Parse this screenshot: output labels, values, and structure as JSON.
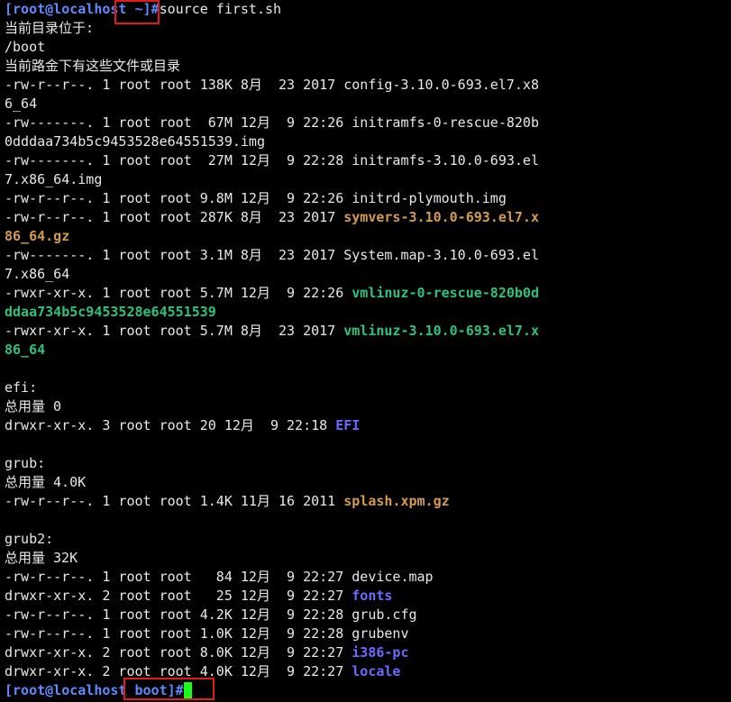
{
  "terminal": {
    "lines": [
      [
        {
          "t": "[root@localhost ~]#",
          "c": "prompt"
        },
        {
          "t": "source first.sh",
          "c": "cmd"
        }
      ],
      [
        {
          "t": "当前目录位于:",
          "c": "default"
        }
      ],
      [
        {
          "t": "/boot",
          "c": "default"
        }
      ],
      [
        {
          "t": "当前路金下有这些文件或目录",
          "c": "default"
        }
      ],
      [
        {
          "t": "-rw-r--r--. 1 root root 138K 8月  23 2017 ",
          "c": "default"
        },
        {
          "t": "config-3.10.0-693.el7.x8",
          "c": "default"
        }
      ],
      [
        {
          "t": "6_64",
          "c": "default"
        }
      ],
      [
        {
          "t": "-rw-------. 1 root root  67M 12月  9 22:26 ",
          "c": "default"
        },
        {
          "t": "initramfs-0-rescue-820b",
          "c": "default"
        }
      ],
      [
        {
          "t": "0dddaa734b5c9453528e64551539.img",
          "c": "default"
        }
      ],
      [
        {
          "t": "-rw-------. 1 root root  27M 12月  9 22:28 ",
          "c": "default"
        },
        {
          "t": "initramfs-3.10.0-693.el",
          "c": "default"
        }
      ],
      [
        {
          "t": "7.x86_64.img",
          "c": "default"
        }
      ],
      [
        {
          "t": "-rw-r--r--. 1 root root 9.8M 12月  9 22:26 ",
          "c": "default"
        },
        {
          "t": "initrd-plymouth.img",
          "c": "default"
        }
      ],
      [
        {
          "t": "-rw-r--r--. 1 root root 287K 8月  23 2017 ",
          "c": "default"
        },
        {
          "t": "symvers-3.10.0-693.el7.x",
          "c": "archive"
        }
      ],
      [
        {
          "t": "86_64.gz",
          "c": "archive"
        }
      ],
      [
        {
          "t": "-rw-------. 1 root root 3.1M 8月  23 2017 ",
          "c": "default"
        },
        {
          "t": "System.map-3.10.0-693.el",
          "c": "default"
        }
      ],
      [
        {
          "t": "7.x86_64",
          "c": "default"
        }
      ],
      [
        {
          "t": "-rwxr-xr-x. 1 root root 5.7M 12月  9 22:26 ",
          "c": "default"
        },
        {
          "t": "vmlinuz-0-rescue-820b0d",
          "c": "exec"
        }
      ],
      [
        {
          "t": "ddaa734b5c9453528e64551539",
          "c": "exec"
        }
      ],
      [
        {
          "t": "-rwxr-xr-x. 1 root root 5.7M 8月  23 2017 ",
          "c": "default"
        },
        {
          "t": "vmlinuz-3.10.0-693.el7.x",
          "c": "exec"
        }
      ],
      [
        {
          "t": "86_64",
          "c": "exec"
        }
      ],
      [],
      [
        {
          "t": "efi:",
          "c": "default"
        }
      ],
      [
        {
          "t": "总用量 0",
          "c": "default"
        }
      ],
      [
        {
          "t": "drwxr-xr-x. 3 root root 20 12月  9 22:18 ",
          "c": "default"
        },
        {
          "t": "EFI",
          "c": "dir"
        }
      ],
      [],
      [
        {
          "t": "grub:",
          "c": "default"
        }
      ],
      [
        {
          "t": "总用量 4.0K",
          "c": "default"
        }
      ],
      [
        {
          "t": "-rw-r--r--. 1 root root 1.4K 11月 16 2011 ",
          "c": "default"
        },
        {
          "t": "splash.xpm.gz",
          "c": "archive"
        }
      ],
      [],
      [
        {
          "t": "grub2:",
          "c": "default"
        }
      ],
      [
        {
          "t": "总用量 32K",
          "c": "default"
        }
      ],
      [
        {
          "t": "-rw-r--r--. 1 root root   84 12月  9 22:27 ",
          "c": "default"
        },
        {
          "t": "device.map",
          "c": "default"
        }
      ],
      [
        {
          "t": "drwxr-xr-x. 2 root root   25 12月  9 22:27 ",
          "c": "default"
        },
        {
          "t": "fonts",
          "c": "dir"
        }
      ],
      [
        {
          "t": "-rw-r--r--. 1 root root 4.2K 12月  9 22:28 ",
          "c": "default"
        },
        {
          "t": "grub.cfg",
          "c": "default"
        }
      ],
      [
        {
          "t": "-rw-r--r--. 1 root root 1.0K 12月  9 22:28 ",
          "c": "default"
        },
        {
          "t": "grubenv",
          "c": "default"
        }
      ],
      [
        {
          "t": "drwxr-xr-x. 2 root root 8.0K 12月  9 22:27 ",
          "c": "default"
        },
        {
          "t": "i386-pc",
          "c": "dir"
        }
      ],
      [
        {
          "t": "drwxr-xr-x. 2 root root 4.0K 12月  9 22:27 ",
          "c": "default"
        },
        {
          "t": "locale",
          "c": "dir"
        }
      ],
      [
        {
          "t": "[root@localhost boot]#",
          "c": "prompt"
        },
        {
          "t": "",
          "c": "cursor"
        }
      ]
    ]
  },
  "colors": {
    "background": "#000000",
    "text": "#e8e8e8",
    "prompt": "#5f8bff",
    "directory": "#6b6bff",
    "executable": "#2ec27e",
    "archive": "#d39b50",
    "cursor": "#1aff1a",
    "highlight_box": "#e31a1a"
  }
}
